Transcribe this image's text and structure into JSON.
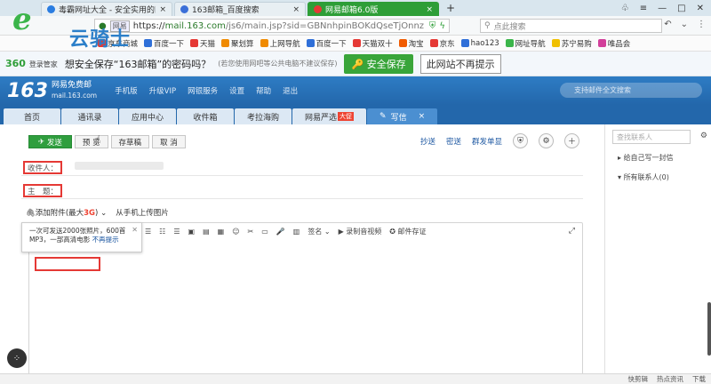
{
  "browser": {
    "tabs": [
      {
        "title": "毒霸网址大全 - 安全实用的网址",
        "active": false,
        "color": "#2a7de1"
      },
      {
        "title": "163邮箱_百度搜索",
        "active": false,
        "color": "#3b6fd8"
      },
      {
        "title": "网易邮箱6.0版",
        "active": true,
        "color": "#e53935"
      }
    ],
    "url_prefix": "https://",
    "url_domain": "mail.163.com",
    "url_rest": "/js6/main.jsp?sid=GBNnhpinBOKdQseTjOnnz",
    "url_tag": "网易",
    "search_placeholder": "点此搜索",
    "logo_text": "云骑士",
    "bookmarks": [
      {
        "label": "京东商城",
        "color": "#e53935"
      },
      {
        "label": "百度一下",
        "color": "#2f6fd8"
      },
      {
        "label": "天猫",
        "color": "#e53935"
      },
      {
        "label": "聚划算",
        "color": "#f08a00"
      },
      {
        "label": "上网导航",
        "color": "#f08a00"
      },
      {
        "label": "百度一下",
        "color": "#2f6fd8"
      },
      {
        "label": "天猫双十",
        "color": "#e53935"
      },
      {
        "label": "淘宝",
        "color": "#f05a00"
      },
      {
        "label": "京东",
        "color": "#e53935"
      },
      {
        "label": "hao123",
        "color": "#2f6fd8"
      },
      {
        "label": "网址导航",
        "color": "#3bb54a"
      },
      {
        "label": "苏宁易购",
        "color": "#f0c000"
      },
      {
        "label": "唯品会",
        "color": "#d23f9a"
      }
    ]
  },
  "notice": {
    "brand": "360",
    "brand_sub": "登录管家",
    "message": "想安全保存“163邮箱”的密码吗？",
    "sub": "(若您使用网吧等公共电脑不建议保存)",
    "save_label": "安全保存",
    "noshow_label": "此网站不再提示"
  },
  "mail": {
    "logo": "163",
    "name": "网易免费邮",
    "site": "mail.163.com",
    "menu": [
      "手机版",
      "升级VIP",
      "网银服务",
      "设置",
      "帮助",
      "退出"
    ],
    "search_placeholder": "支持邮件全文搜索",
    "tabs": [
      {
        "label": "首页"
      },
      {
        "label": "通讯录"
      },
      {
        "label": "应用中心"
      },
      {
        "label": "收件箱"
      },
      {
        "label": "考拉海购"
      },
      {
        "label": "网易严选",
        "badge": "大促"
      },
      {
        "label": "写信",
        "active": true
      }
    ]
  },
  "compose": {
    "send": "发送",
    "preview": "预 览",
    "draft": "存草稿",
    "cancel": "取 消",
    "cc": "抄送",
    "bcc": "密送",
    "single": "群发单显",
    "to_label": "收件人：",
    "subject_label": "主　题：",
    "attach": "添加附件",
    "attach_max_prefix": "(最大",
    "attach_max": "3G",
    "attach_max_suffix": ")",
    "phone_upload": "从手机上传图片",
    "tooltip_line1": "一次可发送2000张照片，600首",
    "tooltip_line2": "MP3，一部高清电影",
    "tooltip_link": "不再提示",
    "sign": "签名",
    "record": "录制音视频",
    "stamp": "邮件存证"
  },
  "sidebar": {
    "search_placeholder": "查找联系人",
    "self": "给自己写一封信",
    "all": "所有联系人(0)"
  },
  "status": {
    "items": [
      "快剪辑",
      "热点资讯",
      "下载"
    ]
  }
}
